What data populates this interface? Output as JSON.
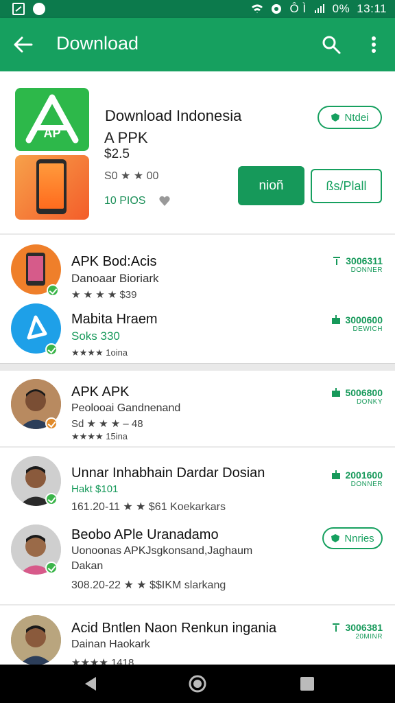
{
  "status": {
    "signal": "Ô Ì",
    "battery": "0%",
    "time": "13:11"
  },
  "appbar": {
    "title": "Download"
  },
  "featured": {
    "title": "Download Indonesia",
    "subtitle": "A PPK",
    "price": "$2.5",
    "rating": "S0 ★ ★ 00",
    "pios": "10 PIOS",
    "outline_small": "Ntdei",
    "solid_button": "nioñ",
    "outline_button": "ßs/Plall"
  },
  "list": [
    {
      "title": "APK Bod:Acis",
      "sub": "Danoaar Bioriark",
      "meta": "★ ★ ★ ★  $39",
      "right_big": "3006311",
      "right_small": "DONNER"
    },
    {
      "title": "Mabita Hraem",
      "sub": "Soks   330",
      "meta": "★★★★  1oina",
      "right_big": "3000600",
      "right_small": "DEWICH"
    },
    {
      "title": "APK APK",
      "sub": "Peolooai Gandnenand",
      "meta": "Sd ★ ★ ★ – 48",
      "meta2": "★★★★  15ina",
      "right_big": "5006800",
      "right_small": "DONKY"
    },
    {
      "title": "Unnar Inhabhain Dardar Dosian",
      "sub": "Hakt   $101",
      "meta": "161.20-11 ★ ★  $61 Koekarkars",
      "right_big": "2001600",
      "right_small": "DONNER"
    },
    {
      "title": "Beobo APle Uranadamo",
      "sub": "Uonoonas APKJsgkonsand,Jaghaum",
      "sub2": "Dakan",
      "meta": "308.20-22 ★ ★  $$IKM slarkang",
      "pill": "Nnries"
    },
    {
      "title": "Acid Bntlen Naon Renkun ingania",
      "sub": "Dainan Haokark",
      "meta": "★★★★  1418",
      "right_big": "3006381",
      "right_small": "20MINR"
    }
  ],
  "colors": {
    "primary": "#16a05f",
    "status": "#0c7a4c",
    "star": "#f4b400"
  }
}
